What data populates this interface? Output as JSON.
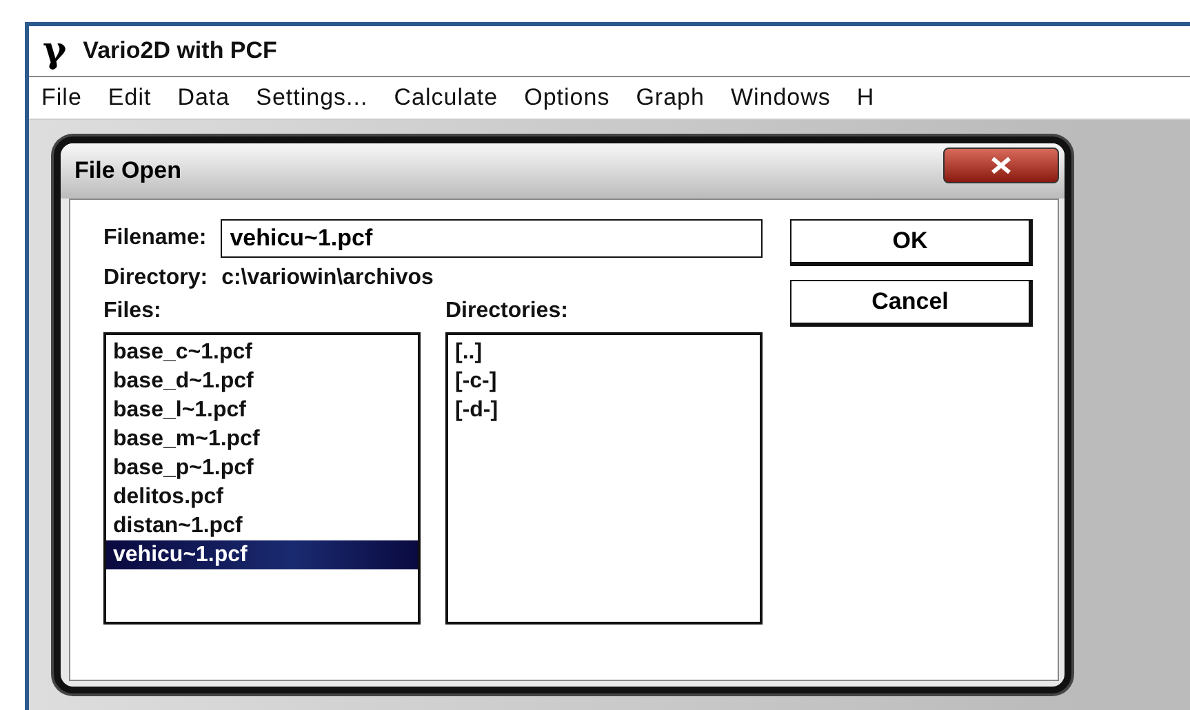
{
  "window": {
    "icon": "γ",
    "title": "Vario2D with PCF"
  },
  "menu": [
    "File",
    "Edit",
    "Data",
    "Settings...",
    "Calculate",
    "Options",
    "Graph",
    "Windows",
    "H"
  ],
  "dialog": {
    "title": "File Open",
    "filename": {
      "label": "Filename:",
      "value": "vehicu~1.pcf"
    },
    "directory": {
      "label": "Directory:",
      "value": "c:\\variowin\\archivos"
    },
    "files": {
      "label": "Files:",
      "items": [
        {
          "name": "base_c~1.pcf",
          "selected": false
        },
        {
          "name": "base_d~1.pcf",
          "selected": false
        },
        {
          "name": "base_l~1.pcf",
          "selected": false
        },
        {
          "name": "base_m~1.pcf",
          "selected": false
        },
        {
          "name": "base_p~1.pcf",
          "selected": false
        },
        {
          "name": "delitos.pcf",
          "selected": false
        },
        {
          "name": "distan~1.pcf",
          "selected": false
        },
        {
          "name": "vehicu~1.pcf",
          "selected": true
        }
      ]
    },
    "directories": {
      "label": "Directories:",
      "items": [
        {
          "name": "[..]",
          "selected": false
        },
        {
          "name": "[-c-]",
          "selected": false
        },
        {
          "name": "[-d-]",
          "selected": false
        }
      ]
    },
    "buttons": [
      "OK",
      "Cancel"
    ]
  }
}
